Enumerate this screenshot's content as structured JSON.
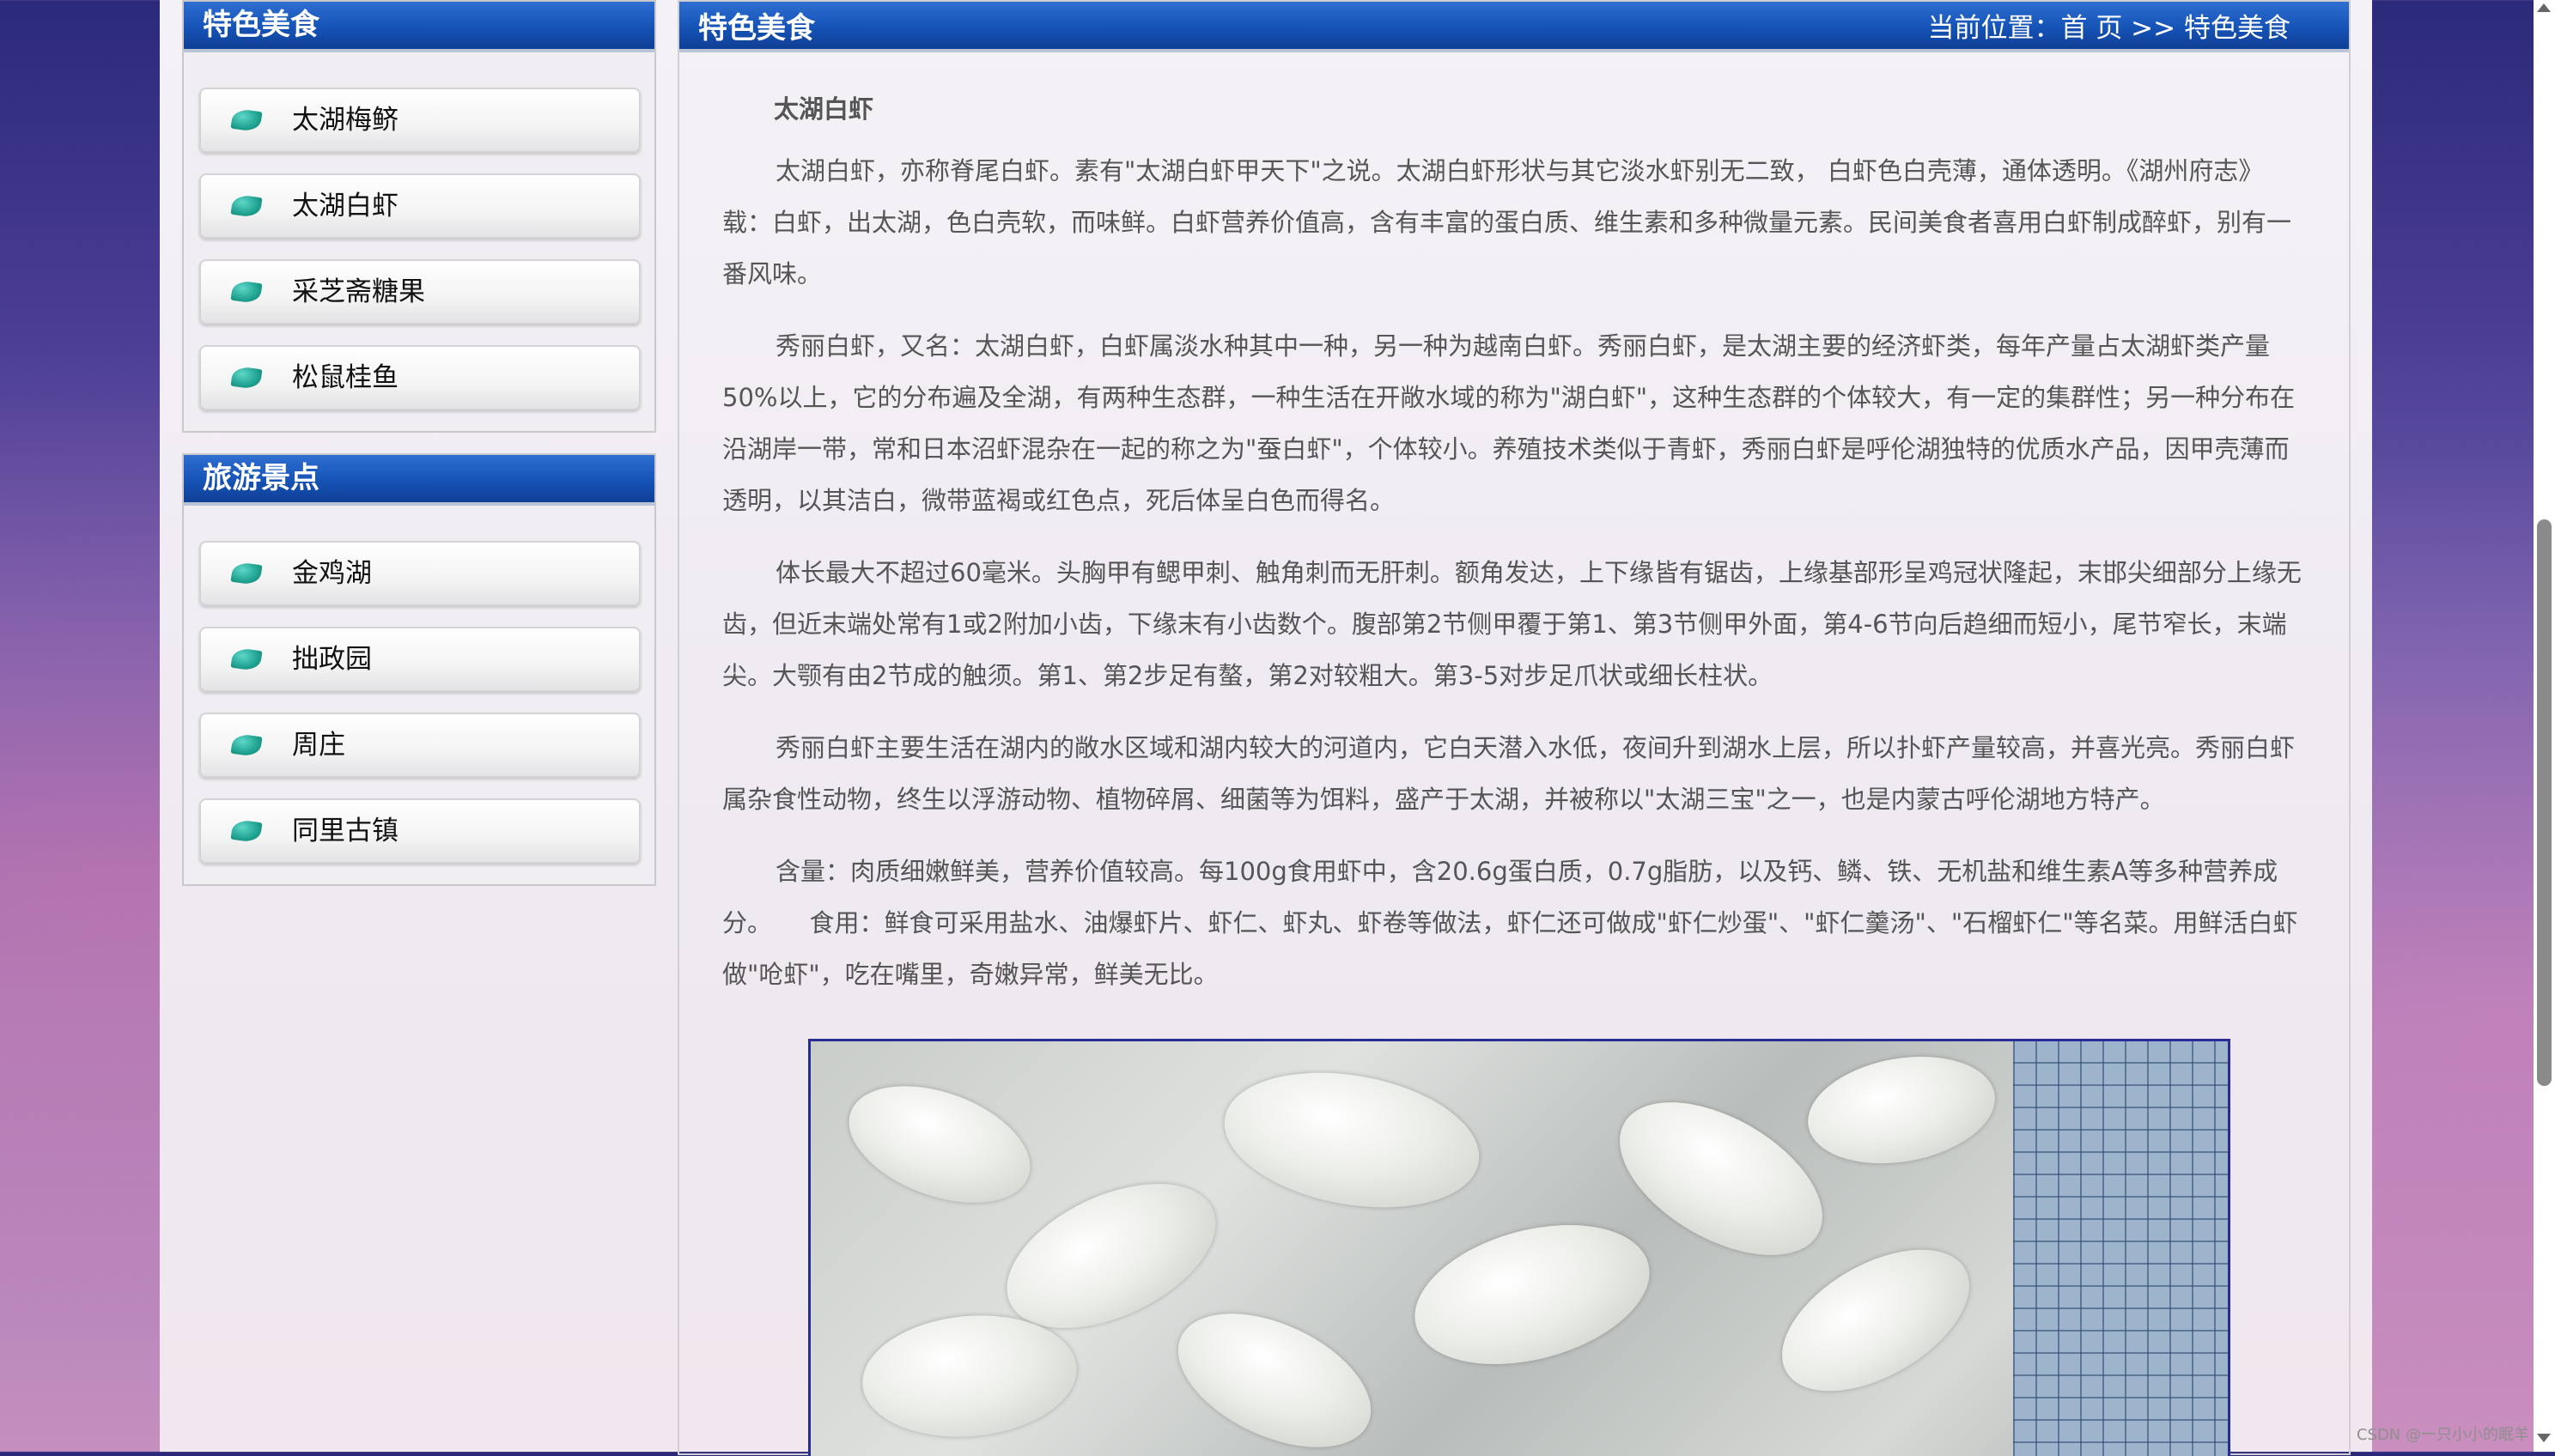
{
  "sidebar": {
    "food": {
      "title": "特色美食",
      "items": [
        {
          "label": "太湖梅鲚"
        },
        {
          "label": "太湖白虾"
        },
        {
          "label": "采芝斋糖果"
        },
        {
          "label": "松鼠桂鱼"
        }
      ]
    },
    "scenic": {
      "title": "旅游景点",
      "items": [
        {
          "label": "金鸡湖"
        },
        {
          "label": "拙政园"
        },
        {
          "label": "周庄"
        },
        {
          "label": "同里古镇"
        }
      ]
    }
  },
  "main": {
    "title": "特色美食",
    "breadcrumb": {
      "prefix": "当前位置：",
      "home": "首 页",
      "separator": " >> ",
      "current": "特色美食"
    },
    "article": {
      "heading": "太湖白虾",
      "paragraphs": [
        "太湖白虾，亦称脊尾白虾。素有\"太湖白虾甲天下\"之说。太湖白虾形状与其它淡水虾别无二致， 白虾色白壳薄，通体透明。《湖州府志》载：白虾，出太湖，色白壳软，而味鲜。白虾营养价值高，含有丰富的蛋白质、维生素和多种微量元素。民间美食者喜用白虾制成醉虾，别有一番风味。",
        "秀丽白虾，又名：太湖白虾，白虾属淡水种其中一种，另一种为越南白虾。秀丽白虾，是太湖主要的经济虾类，每年产量占太湖虾类产量50%以上，它的分布遍及全湖，有两种生态群，一种生活在开敞水域的称为\"湖白虾\"，这种生态群的个体较大，有一定的集群性；另一种分布在沿湖岸一带，常和日本沼虾混杂在一起的称之为\"蚕白虾\"，个体较小。养殖技术类似于青虾，秀丽白虾是呼伦湖独特的优质水产品，因甲壳薄而透明，以其洁白，微带蓝褐或红色点，死后体呈白色而得名。",
        "体长最大不超过60毫米。头胸甲有鳃甲刺、触角刺而无肝刺。额角发达，上下缘皆有锯齿，上缘基部形呈鸡冠状隆起，末邯尖细部分上缘无齿，但近末端处常有1或2附加小齿，下缘末有小齿数个。腹部第2节侧甲覆于第1、第3节侧甲外面，第4-6节向后趋细而短小，尾节窄长，末端尖。大颚有由2节成的触须。第1、第2步足有螯，第2对较粗大。第3-5对步足爪状或细长柱状。",
        "秀丽白虾主要生活在湖内的敞水区域和湖内较大的河道内，它白天潜入水低，夜间升到湖水上层，所以扑虾产量较高，并喜光亮。秀丽白虾属杂食性动物，终生以浮游动物、植物碎屑、细菌等为饵料，盛产于太湖，并被称以\"太湖三宝\"之一，也是内蒙古呼伦湖地方特产。",
        "含量：肉质细嫩鲜美，营养价值较高。每100g食用虾中，含20.6g蛋白质，0.7g脂肪，以及钙、鳞、铁、无机盐和维生素A等多种营养成分。　　食用：鲜食可采用盐水、油爆虾片、虾仁、虾丸、虾卷等做法，虾仁还可做成\"虾仁炒蛋\"、\"虾仁羹汤\"、\"石榴虾仁\"等名菜。用鲜活白虾做\"呛虾\"，吃在嘴里，奇嫩异常，鲜美无比。"
      ]
    }
  },
  "watermark": "CSDN @一只小小的眠羊",
  "colors": {
    "header_blue": "#1553b6",
    "text_gray": "#555555",
    "leaf_teal": "#1ea190"
  },
  "icons": [
    "leaf-bullet-icon",
    "scroll-up-icon",
    "scroll-down-icon"
  ]
}
